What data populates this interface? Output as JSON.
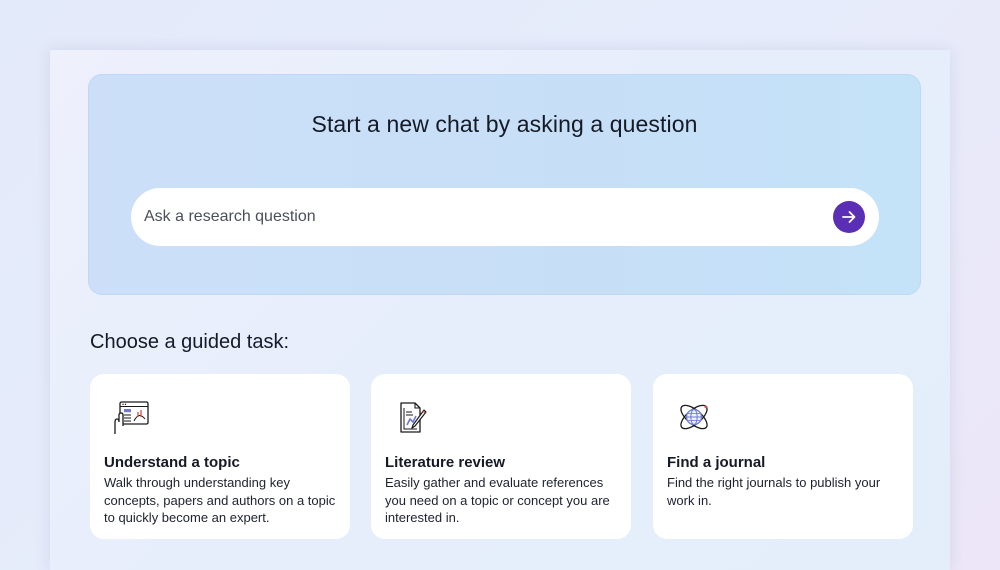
{
  "hero": {
    "title": "Start a new chat by asking a question",
    "search_placeholder": "Ask a research question",
    "submit_icon": "arrow-right-icon"
  },
  "guided": {
    "heading": "Choose a guided task:",
    "cards": [
      {
        "title": "Understand a topic",
        "description": "Walk through understanding key concepts, papers and authors on a topic to quickly become an expert.",
        "icon": "hand-screen-chart-icon"
      },
      {
        "title": "Literature review",
        "description": "Easily gather and evaluate references you need on a topic or concept you are interested in.",
        "icon": "document-pen-icon"
      },
      {
        "title": "Find a journal",
        "description": "Find the right journals to publish your work in.",
        "icon": "globe-orbit-icon"
      }
    ]
  },
  "colors": {
    "accent": "#5a2fb5",
    "hero_background": "#c8dff7",
    "text": "#151a26"
  }
}
